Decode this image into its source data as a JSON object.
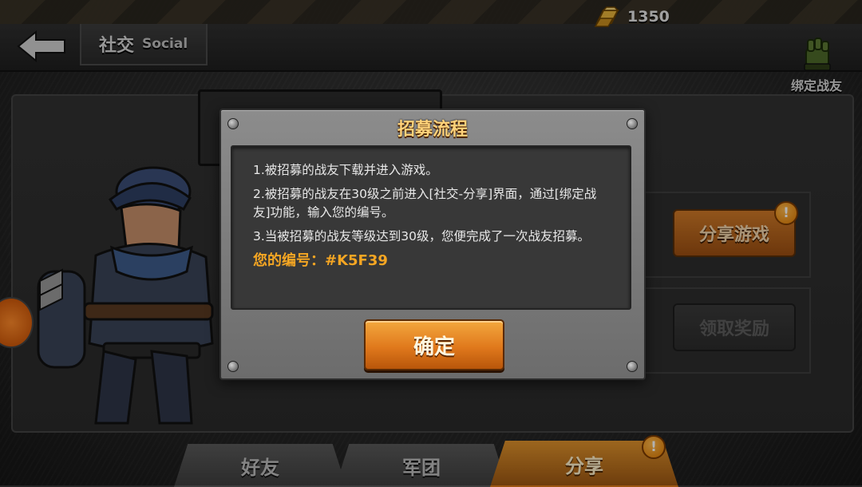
{
  "header": {
    "back_icon": "back-arrow-icon",
    "title_cn": "社交",
    "title_en": "Social",
    "gold_icon": "gold-bar-icon",
    "gold_amount": "1350",
    "bind_friend_icon": "glove-icon",
    "bind_friend_label": "绑定战友"
  },
  "side_buttons": {
    "share_game": {
      "label": "分享游戏",
      "badge": "!"
    },
    "claim_reward": {
      "label": "领取奖励"
    }
  },
  "tabs": [
    {
      "label": "好友",
      "active": false
    },
    {
      "label": "军团",
      "active": false
    },
    {
      "label": "分享",
      "active": true,
      "badge": "!"
    }
  ],
  "modal": {
    "title": "招募流程",
    "steps": [
      "1.被招募的战友下载并进入游戏。",
      "2.被招募的战友在30级之前进入[社交-分享]界面，通过[绑定战友]功能，输入您的编号。",
      "3.当被招募的战友等级达到30级，您便完成了一次战友招募。"
    ],
    "your_id": "您的编号：#K5F39",
    "confirm_label": "确定"
  },
  "colors": {
    "accent_orange": "#e0791c",
    "id_text": "#f5a623",
    "title_gold": "#ffd27a"
  }
}
